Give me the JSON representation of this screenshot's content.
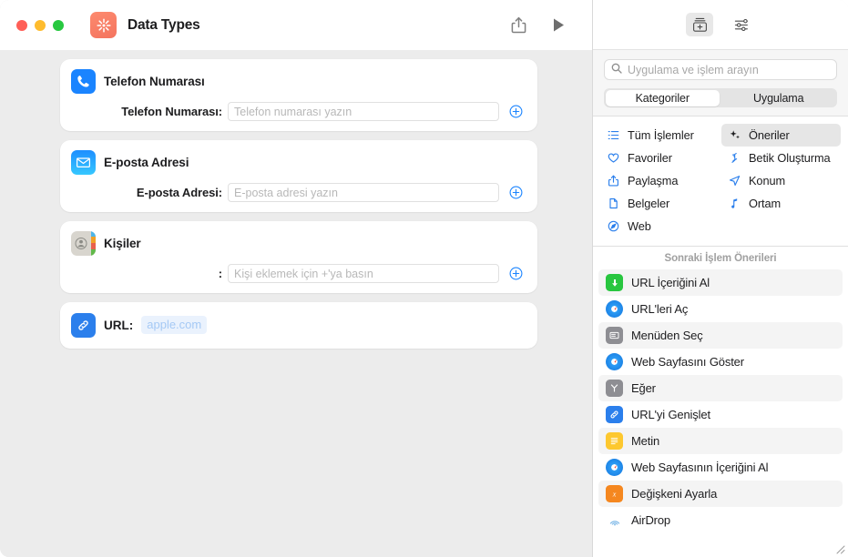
{
  "window": {
    "title": "Data Types",
    "traffic_lights": [
      "close",
      "minimize",
      "zoom"
    ],
    "app_icon": "shortcuts-icon",
    "share_icon": "share-icon",
    "run_icon": "play-icon"
  },
  "actions": [
    {
      "icon": "phone-icon",
      "title": "Telefon Numarası",
      "field_label": "Telefon Numarası:",
      "placeholder": "Telefon numarası yazın",
      "value": "",
      "add_icon": "plus-circle-icon"
    },
    {
      "icon": "mail-icon",
      "title": "E-posta Adresi",
      "field_label": "E-posta Adresi:",
      "placeholder": "E-posta adresi yazın",
      "value": "",
      "add_icon": "plus-circle-icon"
    },
    {
      "icon": "contacts-icon",
      "title": "Kişiler",
      "field_label": ":",
      "placeholder": "Kişi eklemek için +'ya basın",
      "value": "",
      "add_icon": "plus-circle-icon"
    }
  ],
  "url_action": {
    "icon": "link-icon",
    "label": "URL:",
    "value": "apple.com"
  },
  "sidebar": {
    "toolbar": [
      {
        "name": "action-library-icon",
        "active": true
      },
      {
        "name": "sliders-icon",
        "active": false
      }
    ],
    "search": {
      "icon": "search-icon",
      "placeholder": "Uygulama ve işlem arayın",
      "value": ""
    },
    "segments": [
      {
        "label": "Kategoriler",
        "selected": true
      },
      {
        "label": "Uygulama",
        "selected": false
      }
    ],
    "categories": [
      {
        "label": "Tüm İşlemler",
        "icon": "list-icon",
        "selected": false
      },
      {
        "label": "Öneriler",
        "icon": "sparkles-icon",
        "selected": true
      },
      {
        "label": "Favoriler",
        "icon": "heart-icon",
        "selected": false
      },
      {
        "label": "Betik Oluşturma",
        "icon": "script-icon",
        "selected": false
      },
      {
        "label": "Paylaşma",
        "icon": "share-icon",
        "selected": false
      },
      {
        "label": "Konum",
        "icon": "location-icon",
        "selected": false
      },
      {
        "label": "Belgeler",
        "icon": "document-icon",
        "selected": false
      },
      {
        "label": "Ortam",
        "icon": "music-note-icon",
        "selected": false
      },
      {
        "label": "Web",
        "icon": "compass-icon",
        "selected": false
      }
    ],
    "suggestions_title": "Sonraki İşlem Önerileri",
    "suggestions": [
      {
        "label": "URL İçeriğini Al",
        "icon": "download-icon",
        "color": "green"
      },
      {
        "label": "URL'leri Aç",
        "icon": "safari-icon",
        "color": "safari"
      },
      {
        "label": "Menüden Seç",
        "icon": "menu-icon",
        "color": "gray"
      },
      {
        "label": "Web Sayfasını Göster",
        "icon": "safari-icon",
        "color": "safari"
      },
      {
        "label": "Eğer",
        "icon": "branch-icon",
        "color": "gray"
      },
      {
        "label": "URL'yi Genişlet",
        "icon": "link-icon",
        "color": "blue"
      },
      {
        "label": "Metin",
        "icon": "text-icon",
        "color": "yellow"
      },
      {
        "label": "Web Sayfasının İçeriğini Al",
        "icon": "safari-icon",
        "color": "safari"
      },
      {
        "label": "Değişkeni Ayarla",
        "icon": "variable-icon",
        "color": "orange"
      },
      {
        "label": "AirDrop",
        "icon": "airdrop-icon",
        "color": "airdrop"
      }
    ]
  },
  "colors": {
    "accent": "#1a84ff",
    "canvas": "#ececec",
    "card": "#ffffff",
    "selection": "#e6e6e6"
  }
}
